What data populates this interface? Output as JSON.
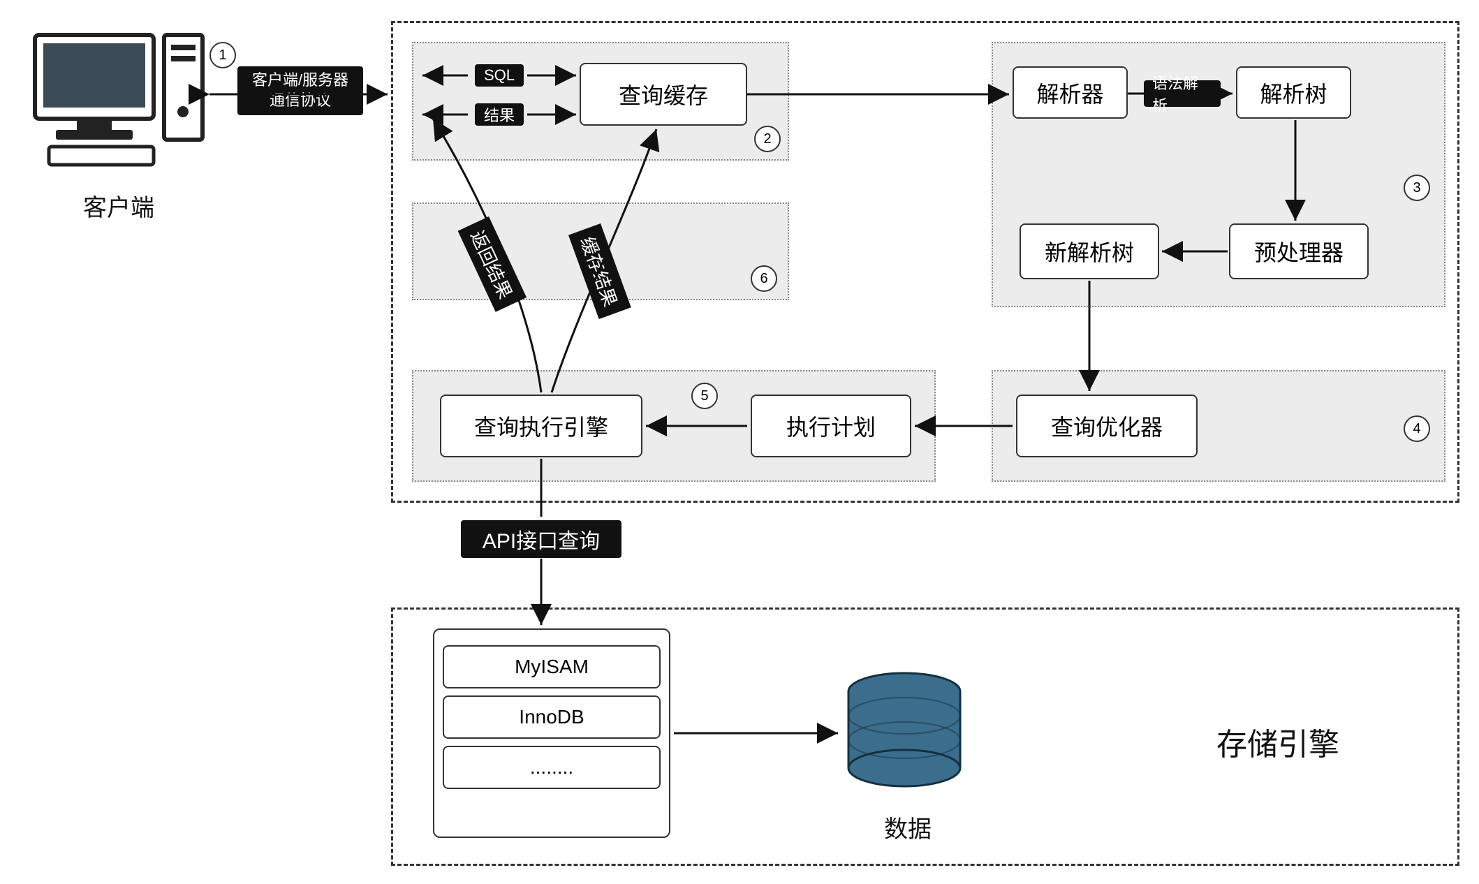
{
  "client": {
    "label": "客户端"
  },
  "protocol": {
    "line1": "客户端/服务器",
    "line2": "通信协议"
  },
  "steps": {
    "s1": "1",
    "s2": "2",
    "s3": "3",
    "s4": "4",
    "s5": "5",
    "s6": "6"
  },
  "flow": {
    "sql": "SQL",
    "result": "结果",
    "query_cache": "查询缓存",
    "parser": "解析器",
    "syntax_parse": "语法解析",
    "parse_tree": "解析树",
    "preprocessor": "预处理器",
    "new_parse_tree": "新解析树",
    "optimizer": "查询优化器",
    "exec_plan": "执行计划",
    "exec_engine": "查询执行引擎",
    "return_result": "返回结果",
    "cache_result": "缓存结果",
    "api_query": "API接口查询"
  },
  "storage": {
    "title": "存储引擎",
    "engines": {
      "e1": "MyISAM",
      "e2": "InnoDB",
      "e3": "........"
    },
    "data_label": "数据"
  }
}
